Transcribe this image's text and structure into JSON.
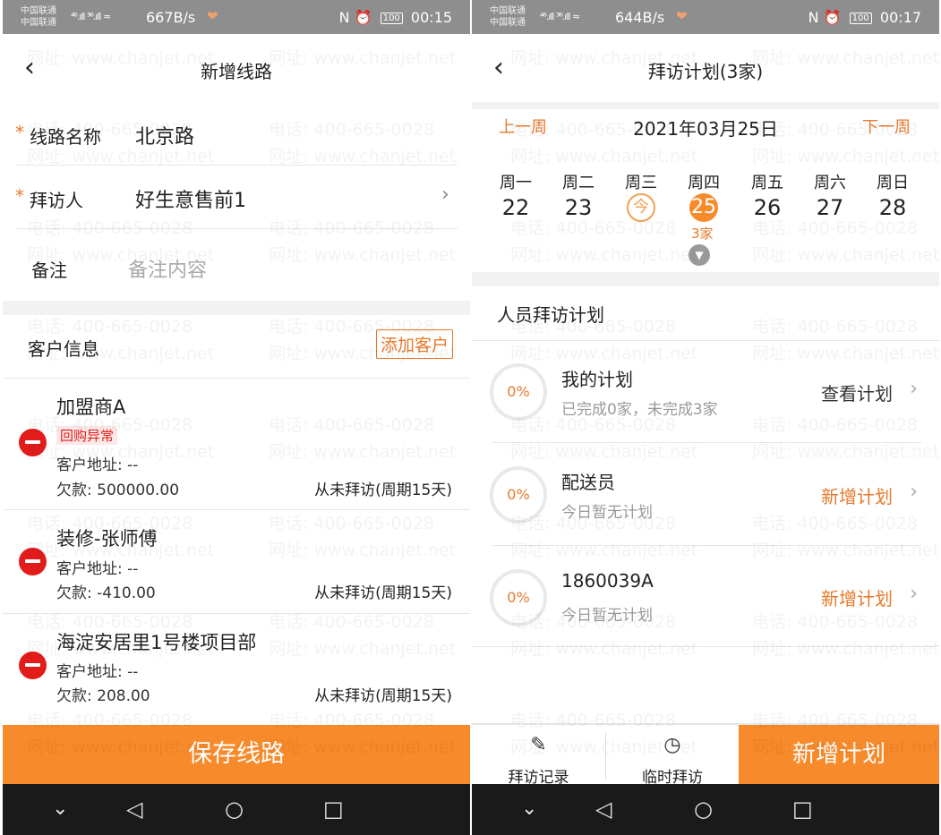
{
  "status_left": {
    "carrier1": "中国联通",
    "carrier2": "中国联通",
    "signal": "⁴⁶.ıll ³⁶.ıll ≈",
    "speed": "667B/s",
    "time": "00:15",
    "battery": "100"
  },
  "status_right": {
    "carrier1": "中国联通",
    "carrier2": "中国联通",
    "signal": "⁴⁶.ıll ³⁶.ıll ≈",
    "speed": "644B/s",
    "time": "00:17",
    "battery": "100"
  },
  "left": {
    "title": "新增线路",
    "route_name_label": "线路名称",
    "route_name_value": "北京路",
    "visitor_label": "拜访人",
    "visitor_value": "好生意售前1",
    "remark_label": "备注",
    "remark_placeholder": "备注内容",
    "customer_info_label": "客户信息",
    "add_customer_label": "添加客户",
    "customers": [
      {
        "name": "加盟商A",
        "tag": "回购异常",
        "address": "客户地址: --",
        "debt": "欠款: 500000.00",
        "visit": "从未拜访(周期15天)"
      },
      {
        "name": "装修-张师傅",
        "tag": "",
        "address": "客户地址: --",
        "debt": "欠款: -410.00",
        "visit": "从未拜访(周期15天)"
      },
      {
        "name": "海淀安居里1号楼项目部",
        "tag": "",
        "address": "客户地址: --",
        "debt": "欠款: 208.00",
        "visit": "从未拜访(周期15天)"
      }
    ],
    "save_label": "保存线路"
  },
  "right": {
    "title": "拜访计划(3家)",
    "prev_week": "上一周",
    "next_week": "下一周",
    "date": "2021年03月25日",
    "days": [
      {
        "label": "周一",
        "num": "22"
      },
      {
        "label": "周二",
        "num": "23"
      },
      {
        "label": "周三",
        "num": "今"
      },
      {
        "label": "周四",
        "num": "25"
      },
      {
        "label": "周五",
        "num": "26"
      },
      {
        "label": "周六",
        "num": "27"
      },
      {
        "label": "周日",
        "num": "28"
      }
    ],
    "selected_count": "3家",
    "section_title": "人员拜访计划",
    "plans": [
      {
        "pct": "0%",
        "name": "我的计划",
        "sub": "已完成0家，未完成3家",
        "action": "查看计划"
      },
      {
        "pct": "0%",
        "name": "配送员",
        "sub": "今日暂无计划",
        "action": "新增计划"
      },
      {
        "pct": "0%",
        "name": "1860039A",
        "sub": "今日暂无计划",
        "action": "新增计划"
      }
    ],
    "tab_record": "拜访记录",
    "tab_temp": "临时拜访",
    "add_plan": "新增计划"
  },
  "watermark": {
    "phone": "电话: 400-665-0028",
    "site": "网址: www.chanjet.net"
  },
  "colors": {
    "accent": "#f78a2a",
    "danger": "#e21b1b",
    "statusbar": "#8e8e8e"
  }
}
